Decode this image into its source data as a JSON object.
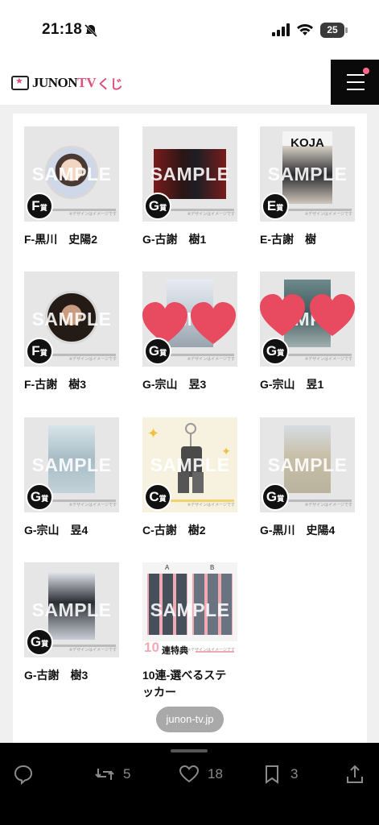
{
  "status_bar": {
    "time": "21:18",
    "battery": "25"
  },
  "header": {
    "logo_part1": "JUNON",
    "logo_part2": "TV",
    "logo_part3": "くじ"
  },
  "watermark": "SAMPLE",
  "design_note": "※デザインはイメージです",
  "items": [
    {
      "label": "F-黒川　史陽2",
      "prize": "F",
      "prize_suffix": "賞"
    },
    {
      "label": "G-古謝　樹1",
      "prize": "G",
      "prize_suffix": "賞"
    },
    {
      "label": "E-古謝　樹",
      "prize": "E",
      "prize_suffix": "賞",
      "header_text": "KOJA"
    },
    {
      "label": "F-古謝　樹3",
      "prize": "F",
      "prize_suffix": "賞"
    },
    {
      "label": "G-宗山　昱3",
      "prize": "G",
      "prize_suffix": "賞"
    },
    {
      "label": "G-宗山　昱1",
      "prize": "G",
      "prize_suffix": "賞"
    },
    {
      "label": "G-宗山　昱4",
      "prize": "G",
      "prize_suffix": "賞"
    },
    {
      "label": "C-古謝　樹2",
      "prize": "C",
      "prize_suffix": "賞"
    },
    {
      "label": "G-黒川　史陽4",
      "prize": "G",
      "prize_suffix": "賞"
    },
    {
      "label": "G-古謝　樹3",
      "prize": "G",
      "prize_suffix": "賞"
    },
    {
      "label": "10連-選べるステッカー",
      "bonus_number": "10",
      "bonus_text": "連特典",
      "col_a": "A",
      "col_b": "B"
    }
  ],
  "url_pill": "junon-tv.jp",
  "actions": {
    "retweets": "5",
    "likes": "18",
    "bookmarks": "3"
  },
  "colors": {
    "brand_pink": "#e0507a",
    "heart_red": "#e84a5f"
  }
}
